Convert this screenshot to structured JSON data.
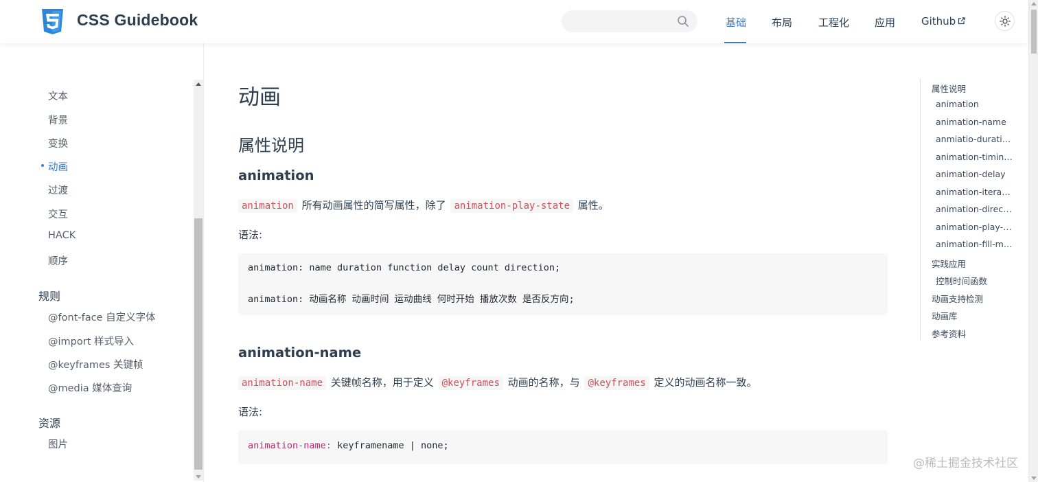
{
  "header": {
    "site_title": "CSS Guidebook",
    "search_icon": "search-icon",
    "nav": [
      {
        "label": "基础",
        "active": true
      },
      {
        "label": "布局",
        "active": false
      },
      {
        "label": "工程化",
        "active": false
      },
      {
        "label": "应用",
        "active": false
      },
      {
        "label": "Github",
        "active": false,
        "icon": "external-link-icon"
      }
    ],
    "theme_toggle_icon": "sun-icon",
    "accent_color": "#3c78d8"
  },
  "sidebar": {
    "items": [
      {
        "label": "文本",
        "active": false
      },
      {
        "label": "背景",
        "active": false
      },
      {
        "label": "变换",
        "active": false
      },
      {
        "label": "动画",
        "active": true
      },
      {
        "label": "过渡",
        "active": false
      },
      {
        "label": "交互",
        "active": false
      },
      {
        "label": "HACK",
        "active": false
      },
      {
        "label": "顺序",
        "active": false
      }
    ],
    "groups": [
      {
        "title": "规则",
        "items": [
          "@font-face 自定义字体",
          "@import 样式导入",
          "@keyframes 关键帧",
          "@media 媒体查询"
        ]
      },
      {
        "title": "资源",
        "items": [
          "图片"
        ]
      }
    ]
  },
  "main": {
    "title": "动画",
    "section_title": "属性说明",
    "animation": {
      "heading": "animation",
      "code1": "animation",
      "text1": "所有动画属性的简写属性，除了",
      "code2": "animation-play-state",
      "text2": "属性。",
      "syntax_label": "语法:",
      "code_line1": "animation: name duration function delay count direction;",
      "code_line2": "animation: 动画名称 动画时间 运动曲线 何时开始 播放次数 是否反方向;"
    },
    "animation_name": {
      "heading": "animation-name",
      "code1": "animation-name",
      "text1": "关键帧名称，用于定义",
      "code2": "@keyframes",
      "text2": "动画的名称，与",
      "code3": "@keyframes",
      "text3": "定义的动画名称一致。",
      "syntax_label": "语法:",
      "code_prop": "animation-name",
      "code_colon": ":",
      "code_rest": " keyframename | none;"
    }
  },
  "toc": {
    "items": [
      {
        "label": "属性说明",
        "level": 1
      },
      {
        "label": "animation",
        "level": 2
      },
      {
        "label": "animation-name",
        "level": 2
      },
      {
        "label": "anmiatio-duration",
        "level": 2
      },
      {
        "label": "animation-timing...",
        "level": 2
      },
      {
        "label": "animation-delay",
        "level": 2
      },
      {
        "label": "animation-iterati...",
        "level": 2
      },
      {
        "label": "animation-directi...",
        "level": 2
      },
      {
        "label": "animation-play-st...",
        "level": 2
      },
      {
        "label": "animation-fill-mo...",
        "level": 2
      },
      {
        "label": "实践应用",
        "level": 1
      },
      {
        "label": "控制时间函数",
        "level": 2
      },
      {
        "label": "动画支持检测",
        "level": 1
      },
      {
        "label": "动画库",
        "level": 1
      },
      {
        "label": "参考资料",
        "level": 1
      }
    ]
  },
  "watermark": "@稀土掘金技术社区"
}
